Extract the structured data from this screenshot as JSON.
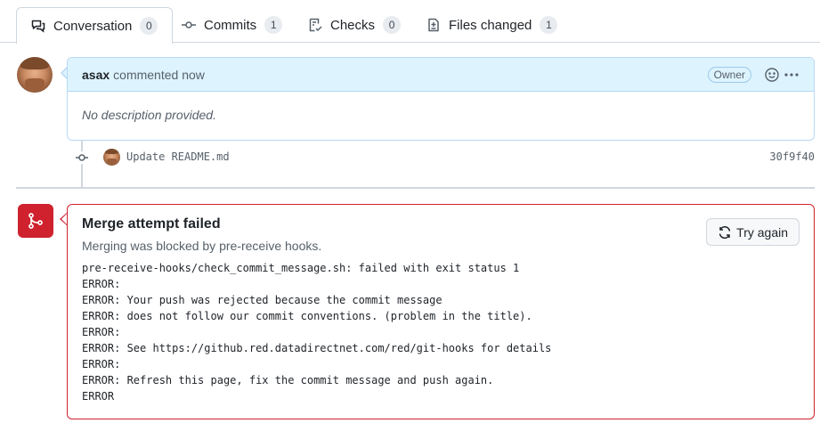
{
  "tabs": [
    {
      "label": "Conversation",
      "count": "0",
      "icon": "comment-discussion-icon",
      "active": true
    },
    {
      "label": "Commits",
      "count": "1",
      "icon": "git-commit-icon"
    },
    {
      "label": "Checks",
      "count": "0",
      "icon": "checklist-icon"
    },
    {
      "label": "Files changed",
      "count": "1",
      "icon": "file-diff-icon"
    }
  ],
  "comment": {
    "author": "asax",
    "action": "commented now",
    "badge": "Owner",
    "body": "No description provided."
  },
  "commit": {
    "message": "Update README.md",
    "sha": "30f9f40"
  },
  "merge": {
    "title": "Merge attempt failed",
    "subtitle": "Merging was blocked by pre-receive hooks.",
    "button": "Try again",
    "log": "pre-receive-hooks/check_commit_message.sh: failed with exit status 1\nERROR:\nERROR: Your push was rejected because the commit message\nERROR: does not follow our commit conventions. (problem in the title).\nERROR:\nERROR: See https://github.red.datadirectnet.com/red/git-hooks for details\nERROR:\nERROR: Refresh this page, fix the commit message and push again.\nERROR"
  },
  "colors": {
    "accent_blue": "#ddf4ff",
    "danger_red": "#cf222e",
    "border": "#d0d7de"
  }
}
